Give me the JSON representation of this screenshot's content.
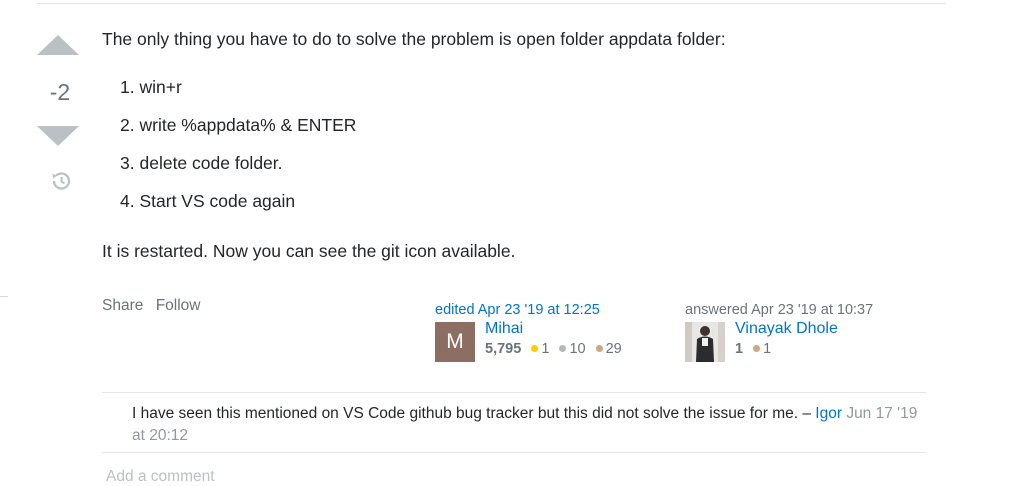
{
  "vote": {
    "count": "-2"
  },
  "post": {
    "intro": "The only thing you have to do to solve the problem is open folder appdata folder:",
    "steps": [
      {
        "num": "1.",
        "text": "win+r"
      },
      {
        "num": "2.",
        "text": "write %appdata% & ENTER"
      },
      {
        "num": "3.",
        "text": "delete code folder."
      },
      {
        "num": "4.",
        "text": "Start VS code again"
      }
    ],
    "outro": "It is restarted. Now you can see the git icon available."
  },
  "menu": {
    "share": "Share",
    "follow": "Follow"
  },
  "editor": {
    "action": "edited Apr 23 '19 at 12:25",
    "avatar_letter": "M",
    "name": "Mihai",
    "rep": "5,795",
    "gold": "1",
    "silver": "10",
    "bronze": "29"
  },
  "author": {
    "action": "answered Apr 23 '19 at 10:37",
    "name": "Vinayak Dhole",
    "rep": "1",
    "bronze": "1"
  },
  "comment": {
    "text": "I have seen this mentioned on VS Code github bug tracker but this did not solve the issue for me.",
    "dash": "–",
    "user": "Igor",
    "date": "Jun 17 '19 at 20:12"
  },
  "add_comment": "Add a comment",
  "colors": {
    "gold": "#ffcc01",
    "silver": "#b4b8bc",
    "bronze": "#d1a684",
    "link": "#0074cc"
  }
}
